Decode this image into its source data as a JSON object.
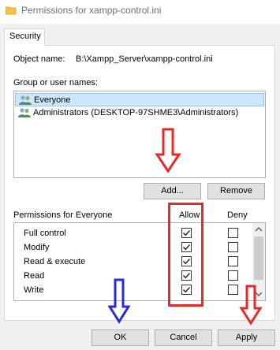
{
  "window": {
    "title": "Permissions for xampp-control.ini"
  },
  "tabs": [
    {
      "label": "Security"
    }
  ],
  "object": {
    "label": "Object name:",
    "value": "B:\\Xampp_Server\\xampp-control.ini"
  },
  "groups": {
    "label": "Group or user names:",
    "items": [
      {
        "name": "Everyone",
        "icon": "users-icon",
        "selected": true
      },
      {
        "name": "Administrators (DESKTOP-97SHME3\\Administrators)",
        "icon": "users-icon",
        "selected": false
      }
    ]
  },
  "buttons": {
    "add": "Add...",
    "remove": "Remove",
    "ok": "OK",
    "cancel": "Cancel",
    "apply": "Apply"
  },
  "permissions": {
    "label": "Permissions for Everyone",
    "allow_header": "Allow",
    "deny_header": "Deny",
    "rows": [
      {
        "name": "Full control",
        "allow": true,
        "deny": false
      },
      {
        "name": "Modify",
        "allow": true,
        "deny": false
      },
      {
        "name": "Read & execute",
        "allow": true,
        "deny": false
      },
      {
        "name": "Read",
        "allow": true,
        "deny": false
      },
      {
        "name": "Write",
        "allow": true,
        "deny": false
      }
    ]
  },
  "colors": {
    "annotation_red": "#e32b2b",
    "annotation_blue": "#2b2bd6",
    "selection": "#cce8ff"
  }
}
